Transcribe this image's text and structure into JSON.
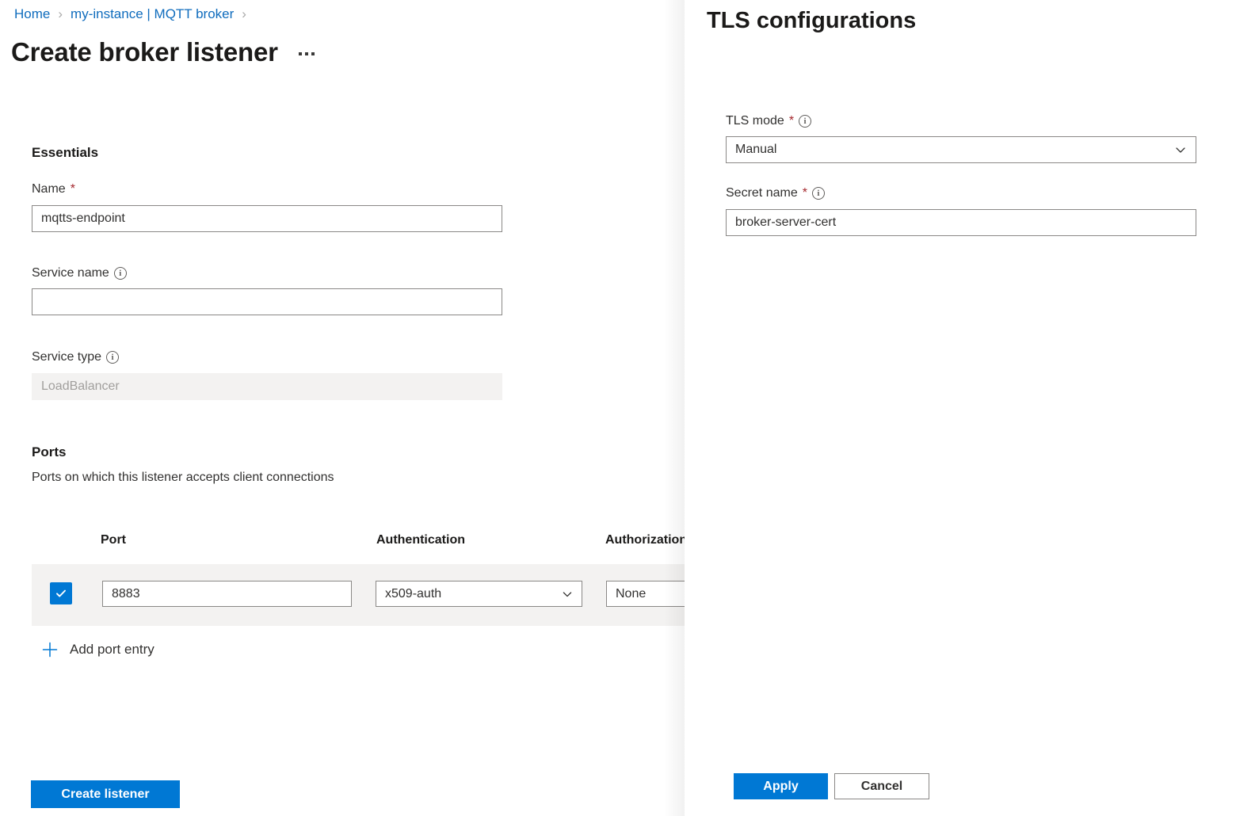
{
  "breadcrumb": {
    "items": [
      {
        "label": "Home"
      },
      {
        "label": "my-instance | MQTT broker"
      }
    ],
    "separator": "›"
  },
  "page": {
    "title": "Create broker listener",
    "more_menu_label": "More"
  },
  "essentials": {
    "heading": "Essentials",
    "name": {
      "label": "Name",
      "required_marker": "*",
      "value": "mqtts-endpoint",
      "placeholder": ""
    },
    "service_name": {
      "label": "Service name",
      "info_icon": "info-icon",
      "value": "",
      "placeholder": ""
    },
    "service_type": {
      "label": "Service type",
      "info_icon": "info-icon",
      "value": "LoadBalancer",
      "disabled": true
    }
  },
  "ports": {
    "heading": "Ports",
    "description": "Ports on which this listener accepts client connections",
    "columns": [
      "Port",
      "Authentication",
      "Authorization"
    ],
    "rows": [
      {
        "selected": true,
        "port": "8883",
        "authentication": "x509-auth",
        "authorization": "None"
      }
    ],
    "add_entry_label": "Add port entry",
    "add_icon": "plus-icon"
  },
  "actions": {
    "create_label": "Create listener"
  },
  "tls_panel": {
    "title": "TLS configurations",
    "mode": {
      "label": "TLS mode",
      "required_marker": "*",
      "info_icon": "info-icon",
      "value": "Manual"
    },
    "secret_name": {
      "label": "Secret name",
      "required_marker": "*",
      "info_icon": "info-icon",
      "value": "broker-server-cert",
      "placeholder": ""
    },
    "apply_label": "Apply",
    "cancel_label": "Cancel"
  },
  "colors": {
    "accent": "#0078d4",
    "link": "#0f6cbd",
    "required": "#a4262c",
    "row_band": "#f3f2f1"
  }
}
